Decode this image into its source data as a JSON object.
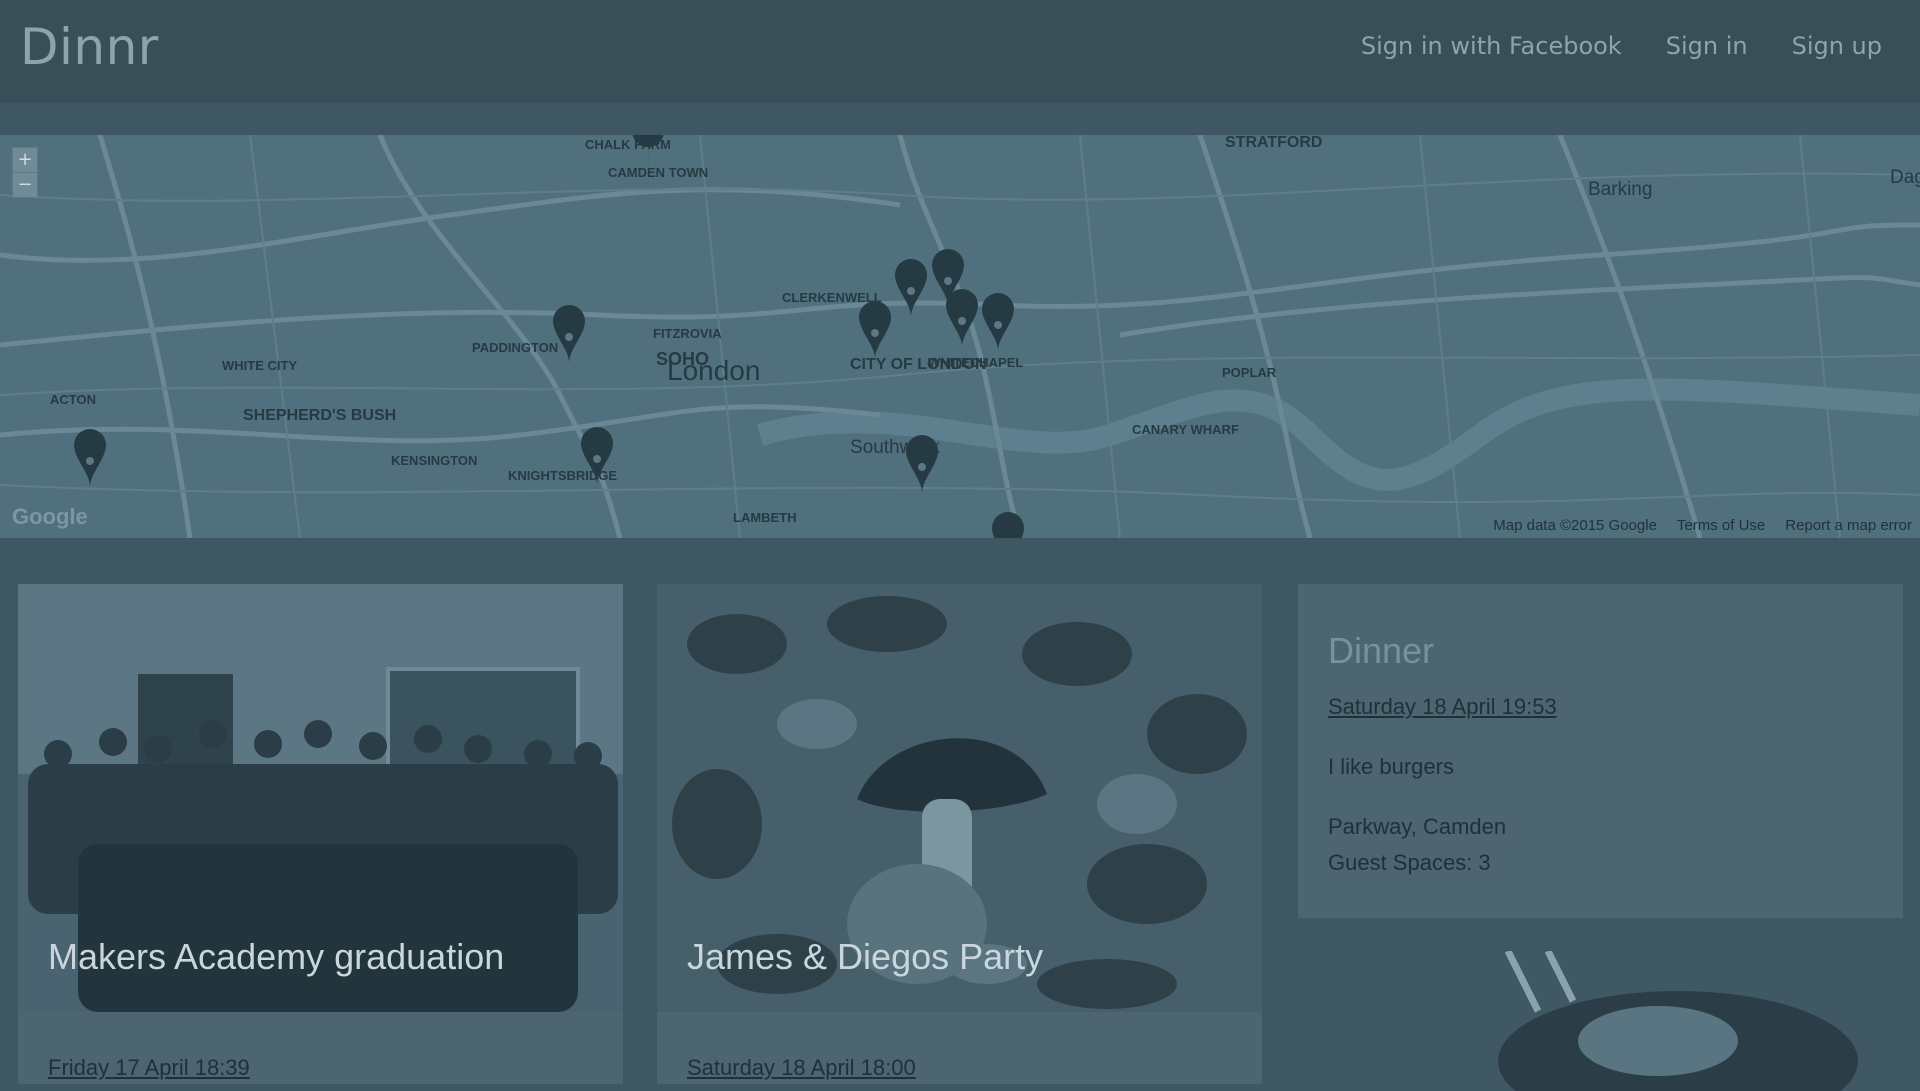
{
  "nav": {
    "brand": "Dinnr",
    "links": [
      "Sign in with Facebook",
      "Sign in",
      "Sign up"
    ]
  },
  "map": {
    "zoom_in": "+",
    "zoom_out": "−",
    "labels": [
      "STRATFORD",
      "Barking",
      "CAMDEN TOWN",
      "CHALK FARM",
      "London",
      "SOHO",
      "FITZROVIA",
      "PADDINGTON",
      "WHITE CITY",
      "SHEPHERD'S BUSH",
      "ACTON",
      "KENSINGTON",
      "KNIGHTSBRIDGE",
      "CLERKENWELL",
      "CITY OF LONDON",
      "WHITECHAPEL",
      "POPLAR",
      "CANARY WHARF",
      "LAMBETH",
      "Southwark",
      "Dag"
    ],
    "google": "Google",
    "footer": [
      "Map data ©2015 Google",
      "Terms of Use",
      "Report a map error"
    ]
  },
  "cards": [
    {
      "title": "Makers Academy graduation",
      "date": "Friday 17 April 18:39"
    },
    {
      "title": "James & Diegos Party",
      "date": "Saturday 18 April 18:00"
    }
  ],
  "info_card": {
    "title": "Dinner",
    "date": "Saturday 18 April 19:53",
    "description": "I like burgers",
    "location": "Parkway, Camden",
    "guest_spaces": "Guest Spaces: 3"
  }
}
